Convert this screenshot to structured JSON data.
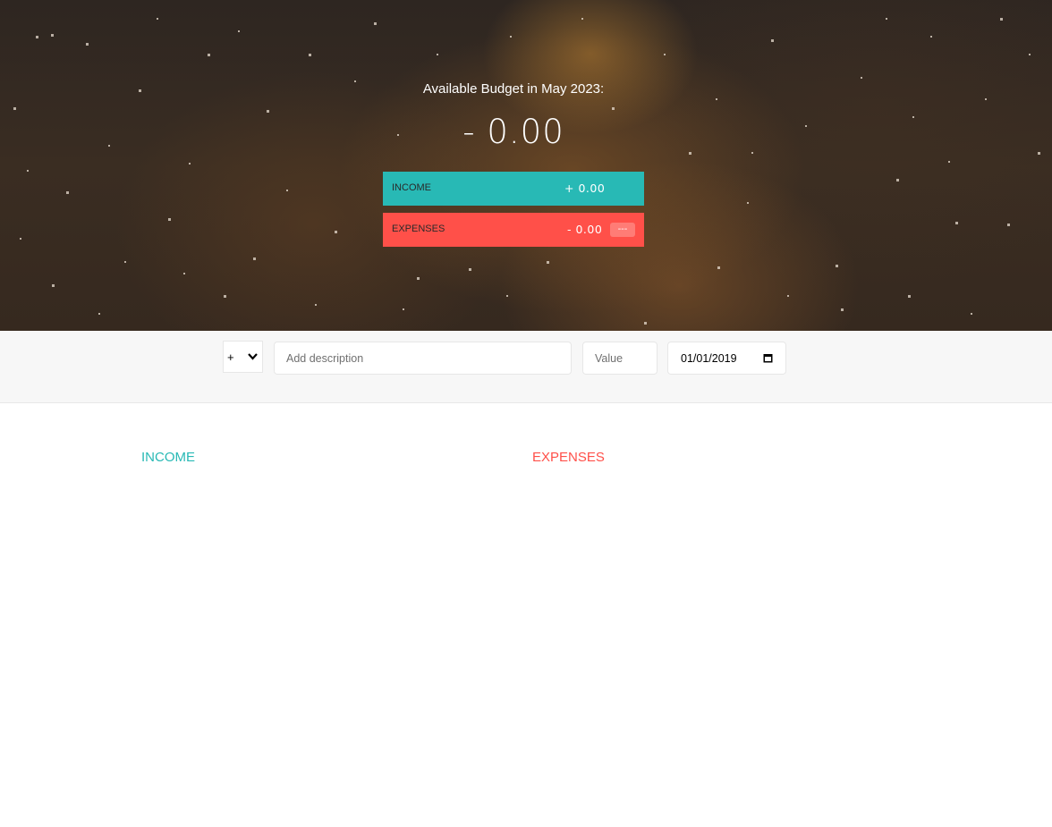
{
  "budget": {
    "title": "Available Budget in May 2023:",
    "value": "- 0.00",
    "income_label": "INCOME",
    "income_value": "+ 0.00",
    "expenses_label": "EXPENSES",
    "expenses_value": "- 0.00",
    "expenses_percentage": "---"
  },
  "add_form": {
    "type_selected": "+",
    "description_placeholder": "Add description",
    "value_placeholder": "Value",
    "date_value": "01/01/2019"
  },
  "lists": {
    "income_title": "Income",
    "expenses_title": "Expenses"
  },
  "colors": {
    "income": "#28b9b5",
    "expenses": "#ff5049"
  },
  "icons": {
    "type_dropdown": "chevron-down-icon",
    "date_picker": "calendar-icon"
  }
}
